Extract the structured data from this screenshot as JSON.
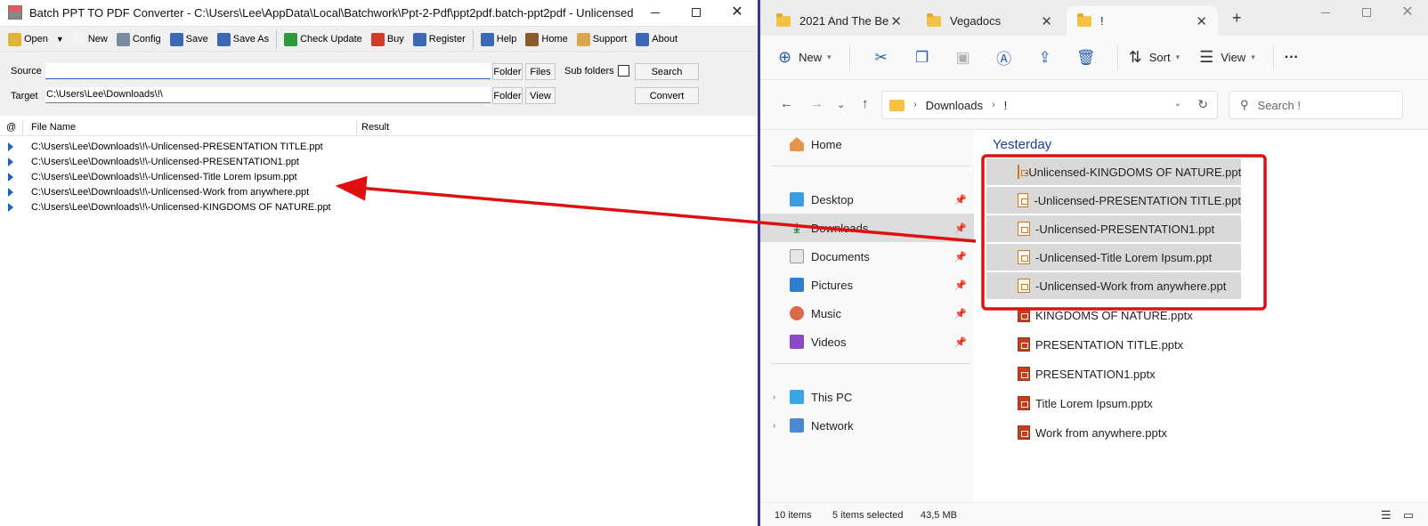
{
  "left_window": {
    "title": "Batch PPT TO PDF Converter - C:\\Users\\Lee\\AppData\\Local\\Batchwork\\Ppt-2-Pdf\\ppt2pdf.batch-ppt2pdf - Unlicensed",
    "toolbar": [
      {
        "label": "Open",
        "icon": "open-folder-icon",
        "color": "#e0b43a"
      },
      {
        "label": "New",
        "icon": "new-document-icon",
        "color": "#f4f4f4"
      },
      {
        "label": "Config",
        "icon": "tools-icon",
        "color": "#7a8ba0"
      },
      {
        "label": "Save",
        "icon": "save-disk-icon",
        "color": "#3c68b5"
      },
      {
        "label": "Save As",
        "icon": "save-as-disk-icon",
        "color": "#3c68b5"
      },
      {
        "label": "Check Update",
        "icon": "check-update-icon",
        "color": "#2f9a3d"
      },
      {
        "label": "Buy",
        "icon": "cart-icon",
        "color": "#d23a2a"
      },
      {
        "label": "Register",
        "icon": "register-icon",
        "color": "#3c68b5"
      },
      {
        "label": "Help",
        "icon": "help-icon",
        "color": "#3c68b5"
      },
      {
        "label": "Home",
        "icon": "home-icon",
        "color": "#8a5b2c"
      },
      {
        "label": "Support",
        "icon": "support-icon",
        "color": "#d9a84e"
      },
      {
        "label": "About",
        "icon": "about-icon",
        "color": "#3c68b5"
      }
    ],
    "form": {
      "source_label": "Source",
      "source_value": "",
      "target_label": "Target",
      "target_value": "C:\\Users\\Lee\\Downloads\\!\\",
      "folder_label": "Folder",
      "files_label": "Files",
      "subfolders_label": "Sub folders",
      "search_label": "Search",
      "view_label": "View",
      "convert_label": "Convert"
    },
    "list_headers": {
      "at": "@",
      "file_name": "File Name",
      "result": "Result"
    },
    "rows": [
      "C:\\Users\\Lee\\Downloads\\!\\-Unlicensed-PRESENTATION TITLE.ppt",
      "C:\\Users\\Lee\\Downloads\\!\\-Unlicensed-PRESENTATION1.ppt",
      "C:\\Users\\Lee\\Downloads\\!\\-Unlicensed-Title Lorem Ipsum.ppt",
      "C:\\Users\\Lee\\Downloads\\!\\-Unlicensed-Work from anywhere.ppt",
      "C:\\Users\\Lee\\Downloads\\!\\-Unlicensed-KINGDOMS OF NATURE.ppt"
    ]
  },
  "right_window": {
    "tabs": [
      "2021 And The Be",
      "Vegadocs",
      "!"
    ],
    "commands": {
      "new": "New",
      "sort": "Sort",
      "view": "View",
      "more": "···"
    },
    "address": {
      "folder": "Downloads",
      "current": "!"
    },
    "search_placeholder": "Search !",
    "nav": {
      "home": "Home",
      "desktop": "Desktop",
      "downloads": "Downloads",
      "documents": "Documents",
      "pictures": "Pictures",
      "music": "Music",
      "videos": "Videos",
      "this_pc": "This PC",
      "network": "Network"
    },
    "group_header": "Yesterday",
    "files": [
      {
        "name": "-Unlicensed-KINGDOMS OF NATURE.ppt",
        "type": "ppt",
        "selected": true
      },
      {
        "name": "-Unlicensed-PRESENTATION TITLE.ppt",
        "type": "ppt",
        "selected": true
      },
      {
        "name": "-Unlicensed-PRESENTATION1.ppt",
        "type": "ppt",
        "selected": true
      },
      {
        "name": "-Unlicensed-Title Lorem Ipsum.ppt",
        "type": "ppt",
        "selected": true
      },
      {
        "name": "-Unlicensed-Work from anywhere.ppt",
        "type": "ppt",
        "selected": true
      },
      {
        "name": "KINGDOMS OF NATURE.pptx",
        "type": "pptx",
        "selected": false
      },
      {
        "name": "PRESENTATION TITLE.pptx",
        "type": "pptx",
        "selected": false
      },
      {
        "name": "PRESENTATION1.pptx",
        "type": "pptx",
        "selected": false
      },
      {
        "name": "Title Lorem Ipsum.pptx",
        "type": "pptx",
        "selected": false
      },
      {
        "name": "Work from anywhere.pptx",
        "type": "pptx",
        "selected": false
      }
    ],
    "status": {
      "items": "10 items",
      "selected": "5 items selected",
      "size": "43,5 MB"
    }
  },
  "colors": {
    "annotation": "#e01010",
    "divider": "#2f3c8f",
    "accent": "#1a3f8f"
  }
}
